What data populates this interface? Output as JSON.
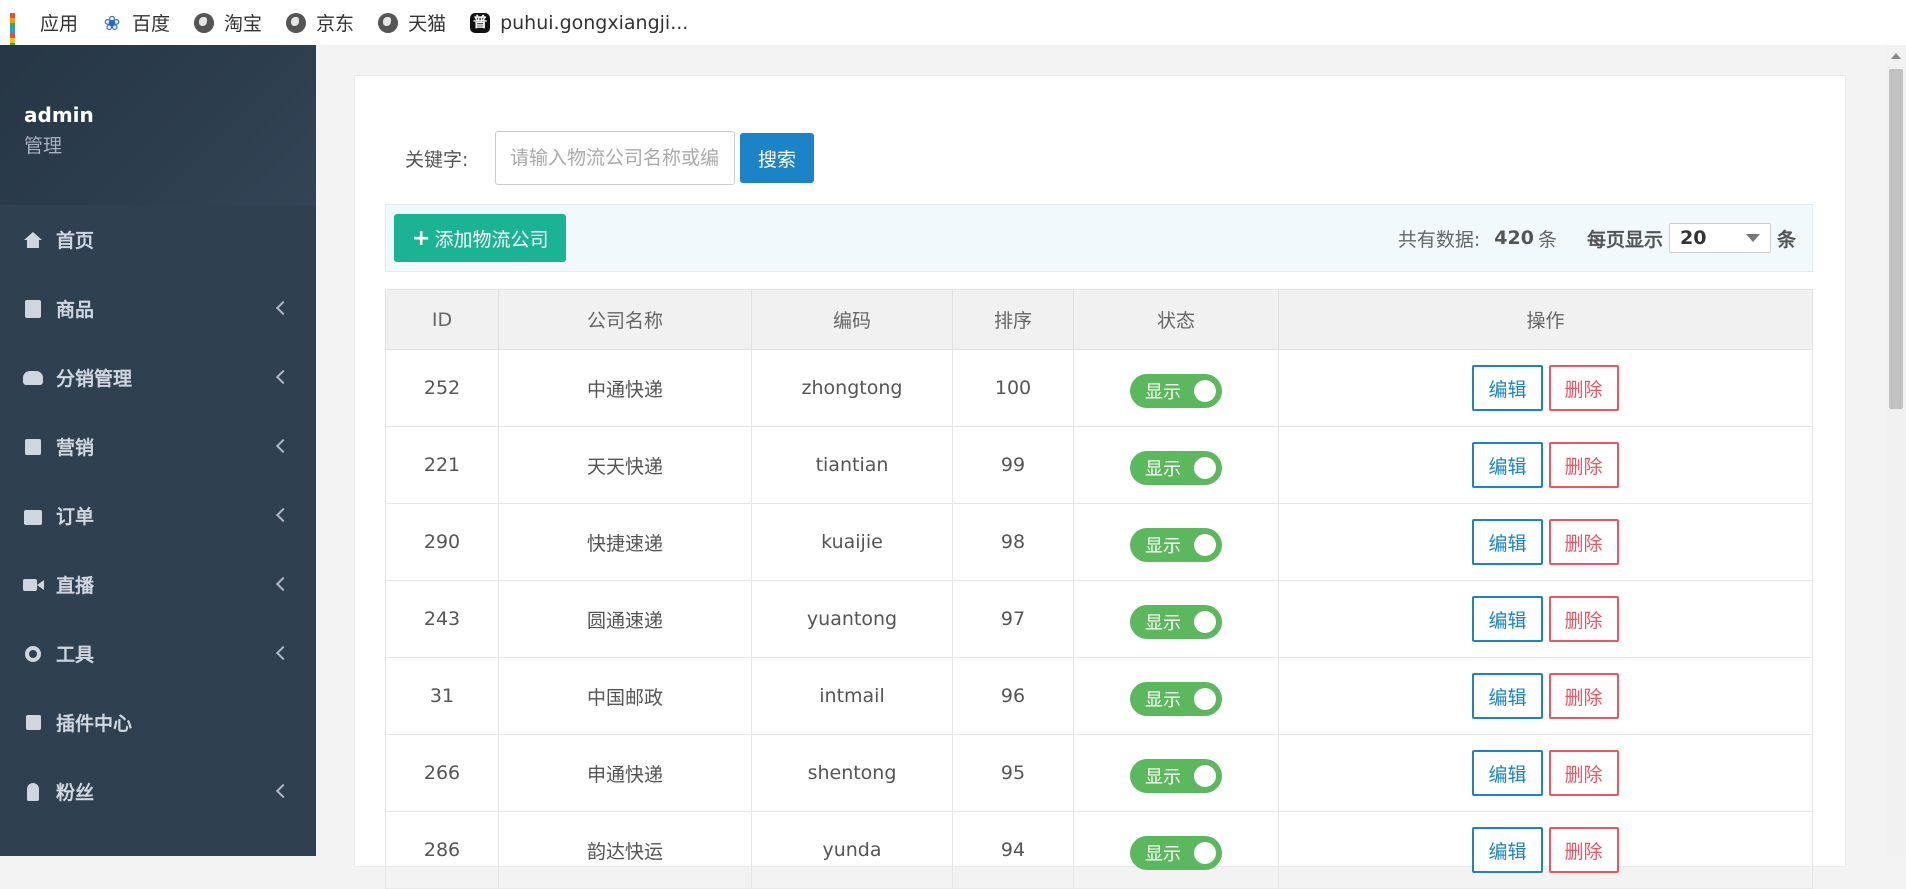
{
  "bookmarks": [
    {
      "label": "应用",
      "icon": "apps-grid-icon"
    },
    {
      "label": "百度",
      "icon": "baidu-paw-icon"
    },
    {
      "label": "淘宝",
      "icon": "globe-icon"
    },
    {
      "label": "京东",
      "icon": "globe-icon"
    },
    {
      "label": "天猫",
      "icon": "globe-icon"
    },
    {
      "label": "puhui.gongxiangji...",
      "icon": "site-favicon-icon",
      "glyph": "普"
    }
  ],
  "profile": {
    "name": "admin",
    "role": "管理"
  },
  "sidebar": {
    "items": [
      {
        "label": "首页",
        "icon": "home-icon",
        "has_submenu": false
      },
      {
        "label": "商品",
        "icon": "product-icon",
        "has_submenu": true
      },
      {
        "label": "分销管理",
        "icon": "users-icon",
        "has_submenu": true
      },
      {
        "label": "营销",
        "icon": "gift-icon",
        "has_submenu": true
      },
      {
        "label": "订单",
        "icon": "shopping-bag-icon",
        "has_submenu": true
      },
      {
        "label": "直播",
        "icon": "video-camera-icon",
        "has_submenu": true
      },
      {
        "label": "工具",
        "icon": "gear-icon",
        "has_submenu": true
      },
      {
        "label": "插件中心",
        "icon": "puzzle-icon",
        "has_submenu": false
      },
      {
        "label": "粉丝",
        "icon": "user-icon",
        "has_submenu": true
      }
    ]
  },
  "search": {
    "label": "关键字:",
    "placeholder": "请输入物流公司名称或编码",
    "value": "",
    "button": "搜索"
  },
  "toolbar": {
    "add_button": "添加物流公司",
    "total_label": "共有数据:",
    "total_count": "420",
    "total_unit": "条",
    "per_page_label": "每页显示",
    "per_page_value": "20",
    "per_page_unit": "条"
  },
  "table": {
    "headers": [
      "ID",
      "公司名称",
      "编码",
      "排序",
      "状态",
      "操作"
    ],
    "status_label": "显示",
    "edit_label": "编辑",
    "delete_label": "删除",
    "rows": [
      {
        "id": "252",
        "name": "中通快递",
        "code": "zhongtong",
        "sort": "100"
      },
      {
        "id": "221",
        "name": "天天快递",
        "code": "tiantian",
        "sort": "99"
      },
      {
        "id": "290",
        "name": "快捷速递",
        "code": "kuaijie",
        "sort": "98"
      },
      {
        "id": "243",
        "name": "圆通速递",
        "code": "yuantong",
        "sort": "97"
      },
      {
        "id": "31",
        "name": "中国邮政",
        "code": "intmail",
        "sort": "96"
      },
      {
        "id": "266",
        "name": "申通快递",
        "code": "shentong",
        "sort": "95"
      },
      {
        "id": "286",
        "name": "韵达快运",
        "code": "yunda",
        "sort": "94"
      }
    ]
  },
  "colors": {
    "sidebar_bg": "#2f4050",
    "primary": "#1c84c6",
    "success": "#1ab394",
    "danger": "#ed5565",
    "toggle_on": "#5cb85c"
  }
}
